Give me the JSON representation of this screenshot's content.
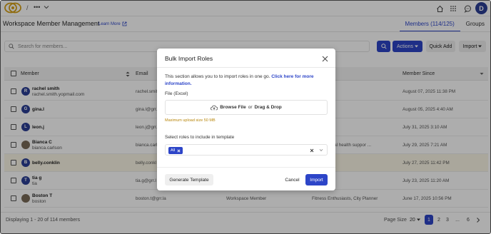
{
  "topbar": {
    "separator": "/",
    "breadcrumb_dots": "•••",
    "avatar_initial": "D"
  },
  "header": {
    "title": "Workspace Member Management",
    "learn_more": "Learn More",
    "tabs": [
      {
        "label": "Members (114/125)",
        "active": true
      },
      {
        "label": "Groups",
        "active": false
      }
    ]
  },
  "toolbar": {
    "search_placeholder": "Search for members...",
    "actions_label": "Actions",
    "quick_add_label": "Quick Add",
    "import_label": "Import"
  },
  "table": {
    "columns": [
      "Member",
      "Email",
      "Member Since"
    ],
    "rows": [
      {
        "initial": "R",
        "name": "rachel smith",
        "sub": "rachel.smith.yopmail.com",
        "email": "rachel.smit",
        "role": "",
        "groups": "x",
        "since": "August 07, 2025 11:38 PM",
        "photo": false,
        "highlight": false
      },
      {
        "initial": "G",
        "name": "gina.l",
        "sub": "",
        "email": "gina.l@grr.l",
        "role": "",
        "groups": "",
        "since": "August 05, 2025 4:40 AM",
        "photo": false,
        "highlight": false
      },
      {
        "initial": "L",
        "name": "leon.j",
        "sub": "",
        "email": "leon.j@grr.",
        "role": "",
        "groups": "thusiasts",
        "since": "July 31, 2025 3:10 AM",
        "photo": false,
        "highlight": false
      },
      {
        "initial": "",
        "name": "Bianca C",
        "sub": "bianca.carlson",
        "email": "bianca.carl",
        "role": "",
        "groups": "ance, Mental health suppor ...",
        "since": "July 29, 2025 7:21 AM",
        "photo": true,
        "highlight": false
      },
      {
        "initial": "B",
        "name": "belly.conklin",
        "sub": "",
        "email": "belly.conkl",
        "role": "",
        "groups": "",
        "since": "July 27, 2025 11:42 PM",
        "photo": false,
        "highlight": true
      },
      {
        "initial": "T",
        "name": "tia g",
        "sub": "tia",
        "email": "tia.g@grr.l",
        "role": "",
        "groups": "",
        "since": "July 23, 2025 11:20 AM",
        "photo": false,
        "highlight": false
      },
      {
        "initial": "",
        "name": "Boston T",
        "sub": "boston",
        "email": "boston.t@grr.la",
        "role": "Workspace Member",
        "groups": "Fitness Enthusiasts, City Planner",
        "since": "June 17, 2025 10:56 PM",
        "photo": true,
        "highlight": false
      }
    ]
  },
  "footer": {
    "displaying": "Displaying 1 - 20 of 114 members",
    "page_size_label": "Page Size",
    "page_size_value": "20",
    "pages": [
      "1",
      "2",
      "3",
      "...",
      "6"
    ]
  },
  "modal": {
    "title": "Bulk Import Roles",
    "description": "This section allows you to to import roles in one go.",
    "link_text": "Click here for more information.",
    "file_label": "File (Excel)",
    "browse_label": "Browse File",
    "or_text": "or",
    "drag_label": "Drag & Drop",
    "max_upload": "Maximum upload size 50 MB",
    "select_label": "Select roles to include in template",
    "chip_label": "All",
    "generate_label": "Generate Template",
    "cancel_label": "Cancel",
    "import_label": "Import"
  },
  "colors": {
    "accent": "#2d45c8",
    "avatar": "#2c3e95",
    "warning_text": "#b8860b",
    "highlight_row": "#fbf6e6"
  }
}
